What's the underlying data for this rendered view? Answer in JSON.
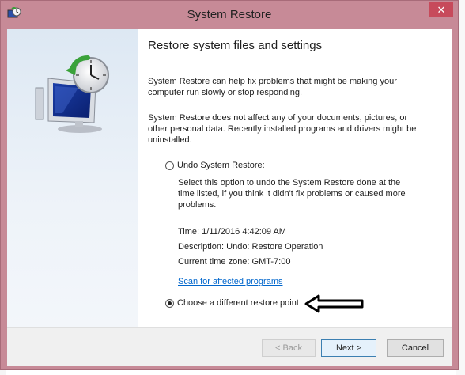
{
  "window": {
    "title": "System Restore",
    "close_label": "✕"
  },
  "content": {
    "heading": "Restore system files and settings",
    "para1": "System Restore can help fix problems that might be making your computer run slowly or stop responding.",
    "para2": "System Restore does not affect any of your documents, pictures, or other personal data. Recently installed programs and drivers might be uninstalled.",
    "undo_option": {
      "label": "Undo System Restore:",
      "selected": false,
      "description": "Select this option to undo the System Restore done at the time listed, if you think it didn't fix problems or caused more problems.",
      "time": "Time: 1/11/2016 4:42:09 AM",
      "desc": "Description: Undo: Restore Operation",
      "timezone": "Current time zone: GMT-7:00",
      "scan_link": "Scan for affected programs"
    },
    "different_option": {
      "label": "Choose a different restore point",
      "selected": true
    }
  },
  "buttons": {
    "back": "< Back",
    "next": "Next >",
    "cancel": "Cancel"
  },
  "colors": {
    "frame": "#c78a97",
    "close": "#c74a5b",
    "link": "#0066cc"
  },
  "icons": {
    "title": "system-restore-icon",
    "illustration": "restore-computer-clock-icon",
    "annotation": "arrow-left-icon"
  }
}
